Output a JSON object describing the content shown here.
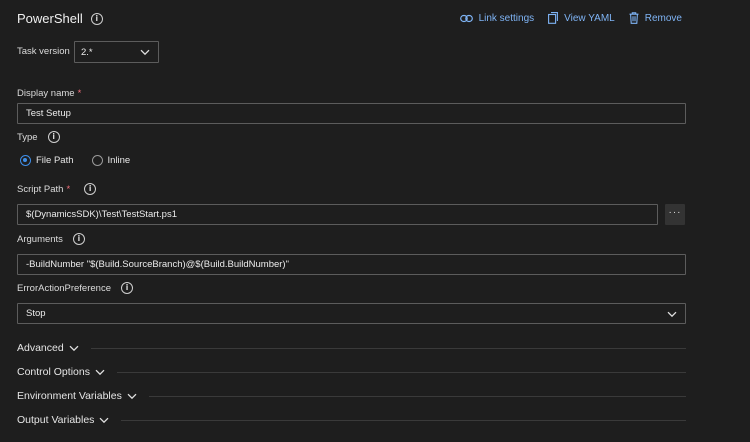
{
  "header": {
    "title": "PowerShell",
    "link_settings": "Link settings",
    "view_yaml": "View YAML",
    "remove": "Remove"
  },
  "task_version": {
    "label": "Task version",
    "value": "2.*"
  },
  "display_name": {
    "label": "Display name",
    "required": "*",
    "value": "Test Setup"
  },
  "type": {
    "label": "Type",
    "options": [
      "File Path",
      "Inline"
    ],
    "selected": "File Path"
  },
  "script_path": {
    "label": "Script Path",
    "required": "*",
    "value": "$(DynamicsSDK)\\Test\\TestStart.ps1",
    "browse": "···"
  },
  "arguments": {
    "label": "Arguments",
    "value": "-BuildNumber \"$(Build.SourceBranch)@$(Build.BuildNumber)\""
  },
  "error_action": {
    "label": "ErrorActionPreference",
    "value": "Stop"
  },
  "sections": [
    "Advanced",
    "Control Options",
    "Environment Variables",
    "Output Variables"
  ],
  "colors": {
    "accent": "#3f8ee8",
    "link": "#7fb4f5",
    "required": "#f1707b",
    "background": "#1e1e1e"
  },
  "icons": {
    "info": "info-icon",
    "link": "link-icon",
    "yaml": "view-yaml-icon",
    "remove": "trash-icon",
    "chevron": "chevron-down-icon"
  }
}
